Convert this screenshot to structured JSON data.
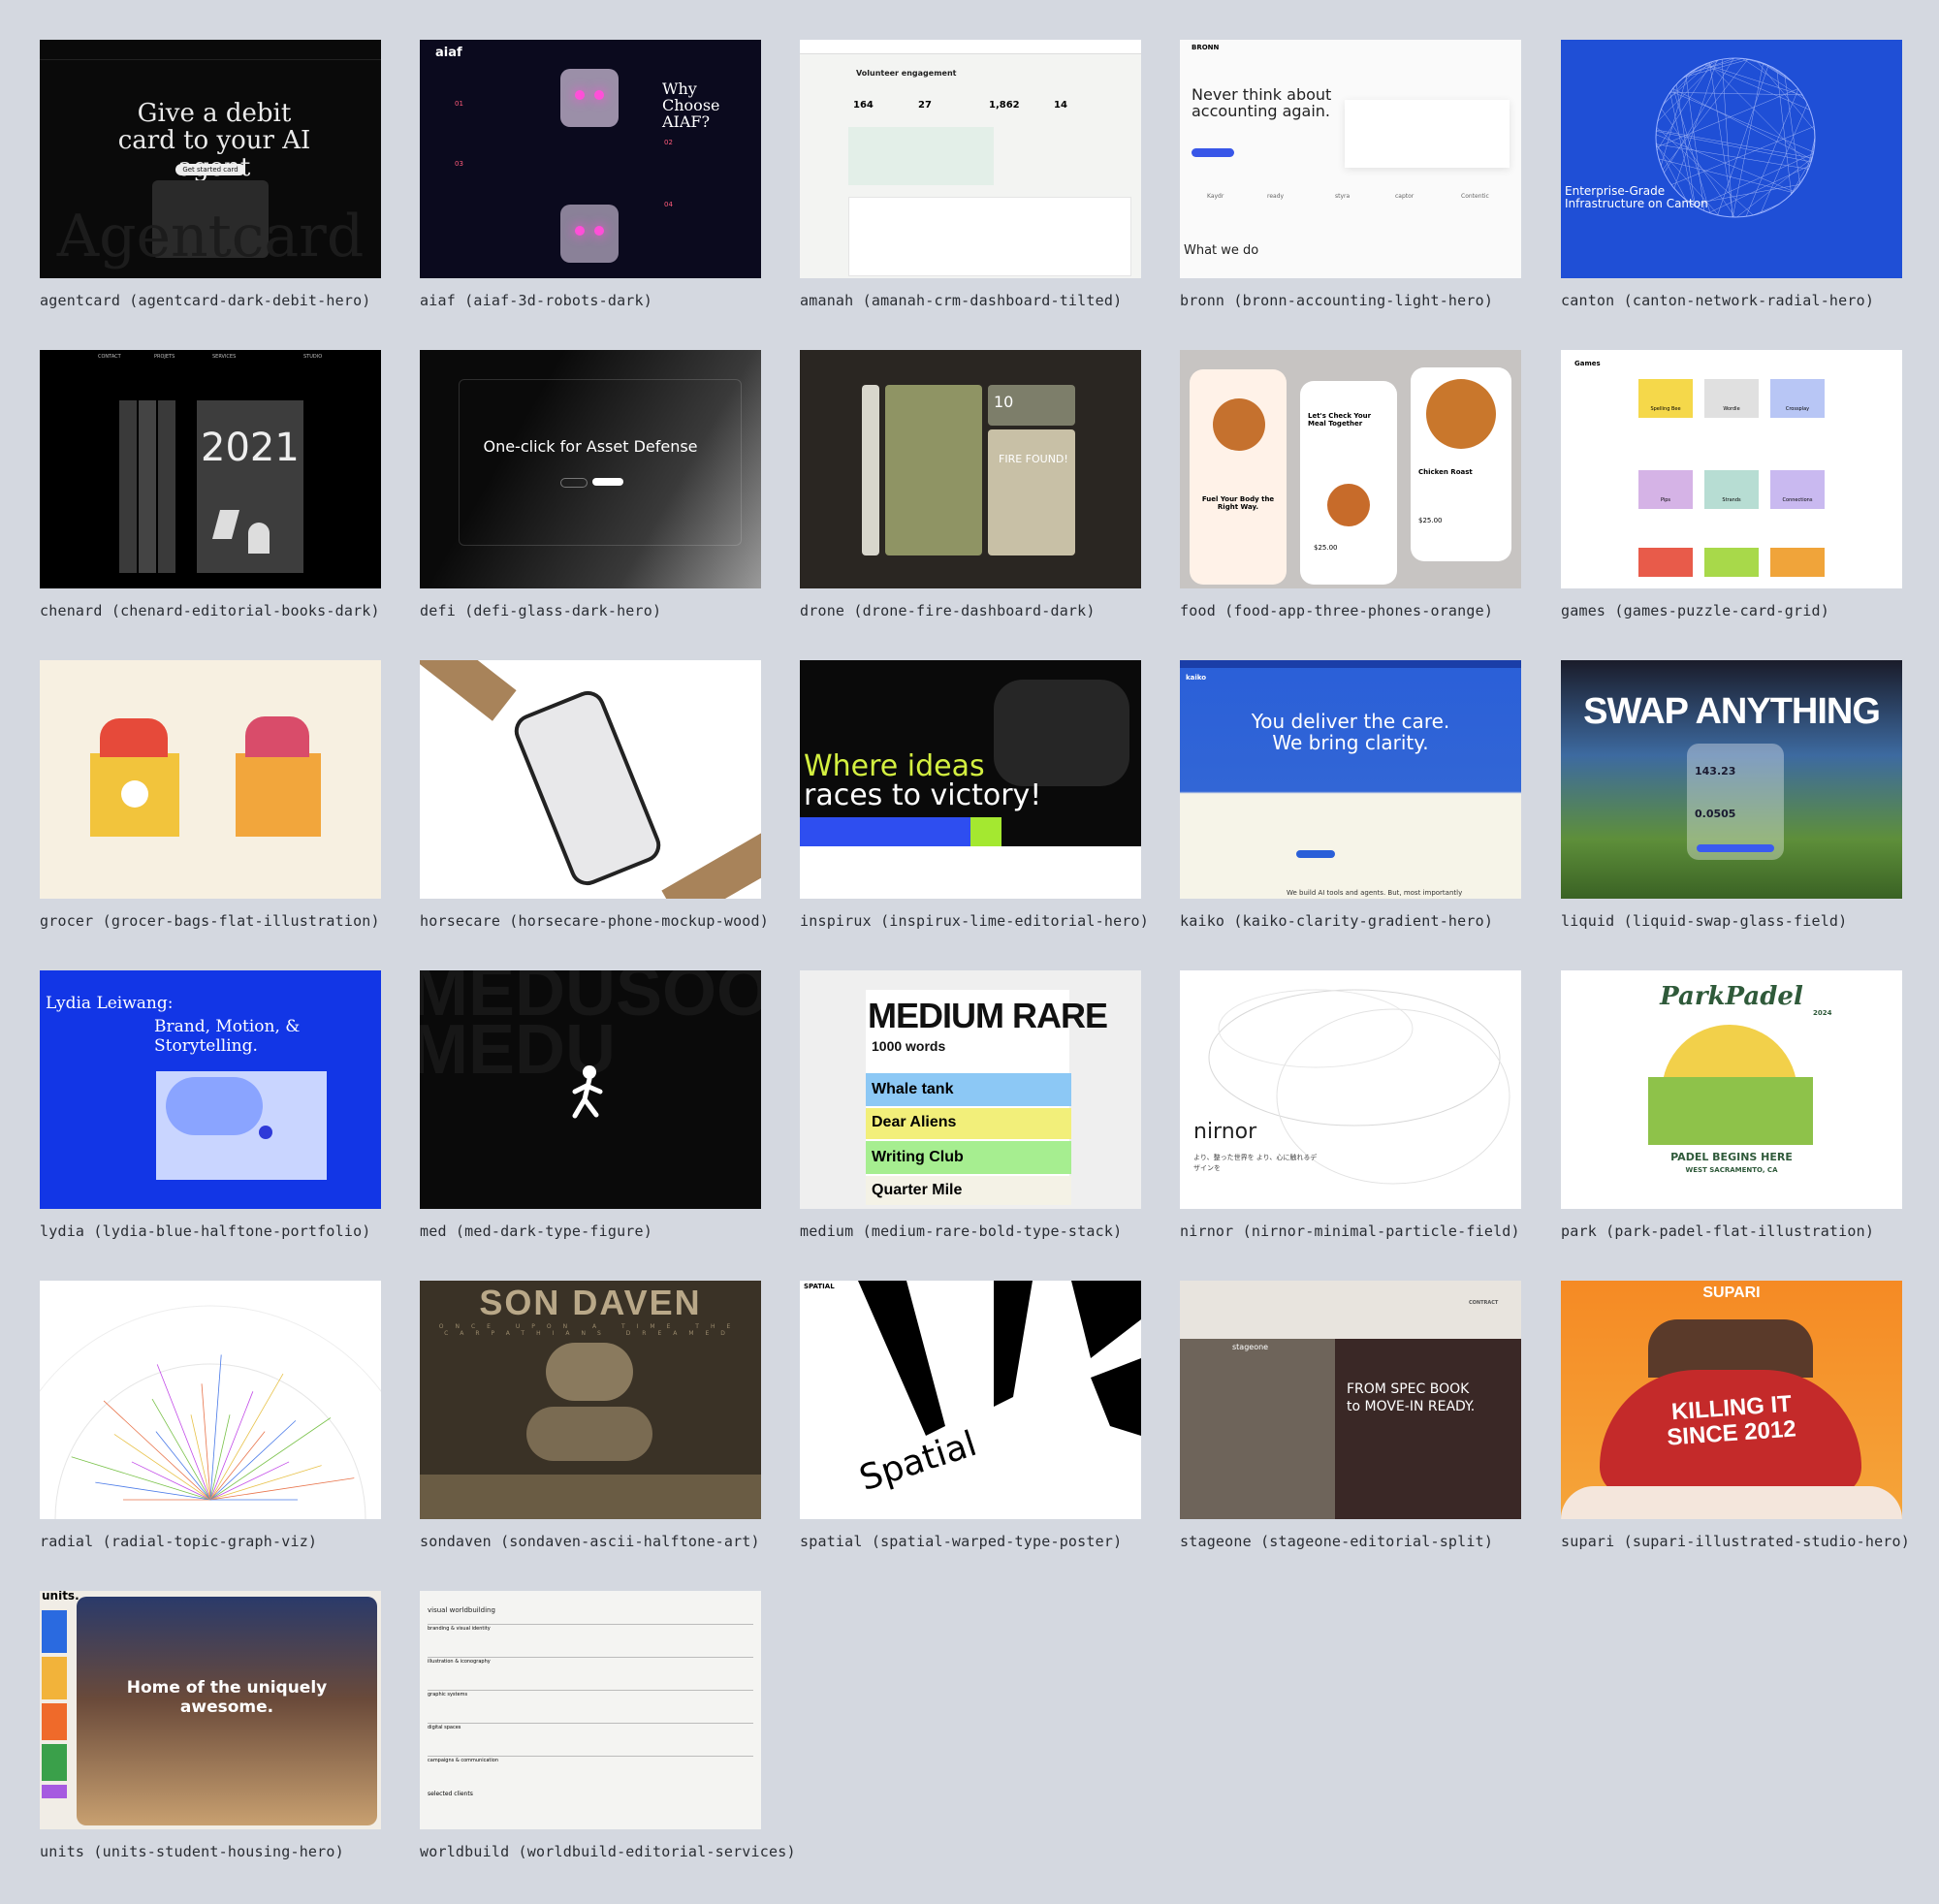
{
  "tiles": [
    {
      "id": "agentcard",
      "caption": "agentcard (agentcard-dark-debit-hero)",
      "headline": "Give a debit card to your AI agent",
      "watermark": "Agentcard",
      "cta": "Get started card"
    },
    {
      "id": "aiaf",
      "caption": "aiaf (aiaf-3d-robots-dark)",
      "brand": "aiaf",
      "headline": "Why Choose AIAF?",
      "n1": "01",
      "n2": "02",
      "n3": "03",
      "n4": "04"
    },
    {
      "id": "amanah",
      "caption": "amanah (amanah-crm-dashboard-tilted)",
      "title": "Volunteer engagement",
      "s1": "164",
      "s2": "27",
      "s3": "1,862",
      "s4": "14"
    },
    {
      "id": "bronn",
      "caption": "bronn (bronn-accounting-light-hero)",
      "brand": "BRONN",
      "headline": "Never think about accounting again.",
      "sub": "What we do",
      "l1": "Kaydr",
      "l2": "ready",
      "l3": "styra",
      "l4": "captor",
      "l5": "Contentic"
    },
    {
      "id": "canton",
      "caption": "canton (canton-network-radial-hero)",
      "headline": "Enterprise-Grade Infrastructure on Canton"
    },
    {
      "id": "chenard",
      "caption": "chenard (chenard-editorial-books-dark)",
      "year": "2021",
      "n1": "CONTACT",
      "n2": "PROJETS",
      "n3": "SERVICES",
      "n4": "STUDIO"
    },
    {
      "id": "defi",
      "caption": "defi (defi-glass-dark-hero)",
      "headline": "One-click for Asset Defense"
    },
    {
      "id": "drone",
      "caption": "drone (drone-fire-dashboard-dark)",
      "alert": "FIRE FOUND!",
      "num": "10"
    },
    {
      "id": "food",
      "caption": "food (food-app-three-phones-orange)",
      "t1": "Fuel Your Body the Right Way.",
      "t2": "Let's Check Your Meal Together",
      "t3": "Chicken Roast",
      "price1": "$25.00",
      "price2": "$25.00"
    },
    {
      "id": "games",
      "caption": "games (games-puzzle-card-grid)",
      "brand": "Games",
      "g1": "Spelling Bee",
      "g2": "Wordle",
      "g3": "Crossplay",
      "g4": "Pips",
      "g5": "Strands",
      "g6": "Connections"
    },
    {
      "id": "grocer",
      "caption": "grocer (grocer-bags-flat-illustration)"
    },
    {
      "id": "horsecare",
      "caption": "horsecare (horsecare-phone-mockup-wood)"
    },
    {
      "id": "inspirux",
      "caption": "inspirux (inspirux-lime-editorial-hero)",
      "headline1": "Where ideas",
      "headline2": "races to victory!"
    },
    {
      "id": "kaiko",
      "caption": "kaiko (kaiko-clarity-gradient-hero)",
      "brand": "kaiko",
      "headline1": "You deliver the care.",
      "headline2": "We bring clarity.",
      "foot": "We build AI tools and agents. But, most importantly"
    },
    {
      "id": "liquid",
      "caption": "liquid (liquid-swap-glass-field)",
      "headline": "SWAP ANYTHING",
      "v1": "143.23",
      "v2": "0.0505"
    },
    {
      "id": "lydia",
      "caption": "lydia (lydia-blue-halftone-portfolio)",
      "l1": "Lydia Leiwang:",
      "l2": "Brand, Motion, & Storytelling."
    },
    {
      "id": "med",
      "caption": "med (med-dark-type-figure)",
      "bg": "MEDUSOOMEDU"
    },
    {
      "id": "medium",
      "caption": "medium (medium-rare-bold-type-stack)",
      "title": "MEDIUM RARE",
      "sub": "1000 words",
      "r1": "Whale tank",
      "r2": "Dear Aliens",
      "r3": "Writing Club",
      "r4": "Quarter Mile"
    },
    {
      "id": "nirnor",
      "caption": "nirnor (nirnor-minimal-particle-field)",
      "brand": "nirnor",
      "jp": "より、整った世界を より、心に触れるデザインを"
    },
    {
      "id": "park",
      "caption": "park (park-padel-flat-illustration)",
      "brand": "ParkPadel",
      "year": "2024",
      "t1": "PADEL BEGINS HERE",
      "t2": "WEST SACRAMENTO, CA"
    },
    {
      "id": "radial",
      "caption": "radial (radial-topic-graph-viz)"
    },
    {
      "id": "sondaven",
      "caption": "sondaven (sondaven-ascii-halftone-art)",
      "title": "SON DAVEN",
      "sub": "ONCE UPON A TIME THE CARPATHIANS DREAMED"
    },
    {
      "id": "spatial",
      "caption": "spatial (spatial-warped-type-poster)",
      "label": "SPATIAL",
      "word": "Spatial"
    },
    {
      "id": "stageone",
      "caption": "stageone (stageone-editorial-split)",
      "brand": "stageone",
      "headline1": "FROM SPEC BOOK",
      "headline2": "to MOVE-IN READY.",
      "contract": "CONTRACT"
    },
    {
      "id": "supari",
      "caption": "supari (supari-illustrated-studio-hero)",
      "brand": "SUPARI",
      "t1": "KILLING IT",
      "t2": "SINCE 2012"
    },
    {
      "id": "units",
      "caption": "units (units-student-housing-hero)",
      "brand": "units.",
      "headline1": "Home of the uniquely",
      "headline2": "awesome."
    },
    {
      "id": "worldbuild",
      "caption": "worldbuild (worldbuild-editorial-services)",
      "title": "visual worldbuilding",
      "s1": "branding & visual identity",
      "s2": "illustration & iconography",
      "s3": "graphic systems",
      "s4": "digital spaces",
      "s5": "campaigns & communication",
      "clients": "selected clients"
    }
  ]
}
